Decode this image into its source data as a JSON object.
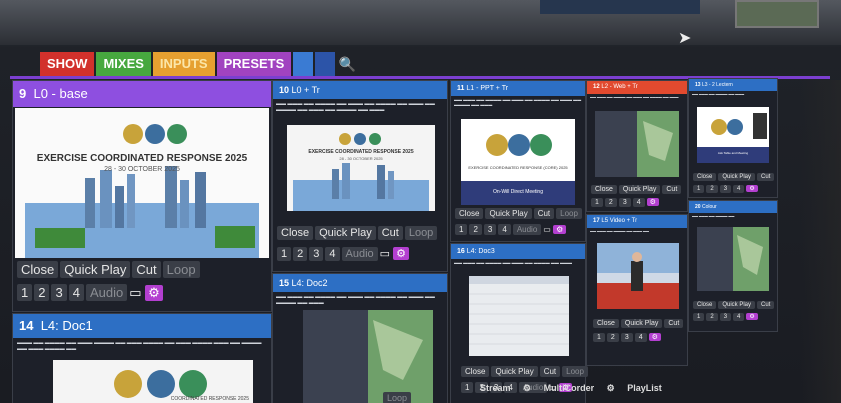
{
  "tabs": [
    "SHOW",
    "MIXES",
    "INPUTS",
    "PRESETS"
  ],
  "tiles": {
    "t9": {
      "num": "9",
      "name": "L0 - base",
      "slide_title": "EXERCISE COORDINATED RESPONSE 2025",
      "slide_sub": "28 - 30 OCTOBER 2025"
    },
    "t10": {
      "num": "10",
      "name": "L0 + Tr",
      "slide_title": "EXERCISE COORDINATED RESPONSE 2025",
      "slide_sub": "28 - 30 OCTOBER 2025"
    },
    "t11": {
      "num": "11",
      "name": "L1 - PPT + Tr",
      "slide_title": "EXERCISE COORDINATED RESPONSE (CORE) 2025",
      "slide_sub": "On-Will Direct Meeting"
    },
    "t12": {
      "num": "12",
      "name": "L2 - Web + Tr"
    },
    "t13": {
      "num": "13",
      "name": "L3 - 2 Lectern",
      "slide_sub": "Ask Table and Meeting"
    },
    "t14": {
      "num": "14",
      "name": "L4: Doc1",
      "slide_title": "COORDINATED RESPONSE 2025"
    },
    "t15": {
      "num": "15",
      "name": "L4: Doc2"
    },
    "t16": {
      "num": "16",
      "name": "L4: Doc3"
    },
    "t17": {
      "num": "17",
      "name": "L5 Video + Tr"
    },
    "t20": {
      "num": "20",
      "name": "Colour"
    }
  },
  "controls": {
    "close": "Close",
    "quick_play": "Quick Play",
    "cut": "Cut",
    "loop": "Loop",
    "audio": "Audio",
    "overlays": [
      "1",
      "2",
      "3",
      "4"
    ]
  },
  "bottom_bar": {
    "stream": "Stream",
    "multicorder": "MultiCorder",
    "playlist": "PlayList"
  },
  "colors": {
    "purple": "#8e4fe0",
    "blue": "#2d6fc4",
    "red": "#e24a2f",
    "gear": "#b33fd0"
  },
  "icons": [
    "search-icon",
    "monitor-icon",
    "gear-icon",
    "cursor-icon"
  ]
}
